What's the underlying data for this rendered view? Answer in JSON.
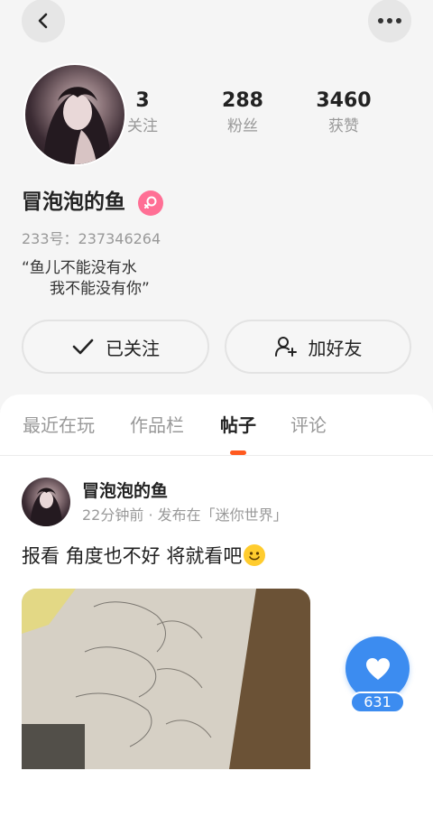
{
  "profile": {
    "username": "冒泡泡的鱼",
    "uid_text": "233号：237346264",
    "bio_line1": "“鱼儿不能没有水",
    "bio_line2": "我不能没有你”",
    "gender": "female"
  },
  "stats": {
    "following": {
      "value": "3",
      "label": "关注"
    },
    "fans": {
      "value": "288",
      "label": "粉丝"
    },
    "likes": {
      "value": "3460",
      "label": "获赞"
    }
  },
  "actions": {
    "follow_label": "已关注",
    "add_friend_label": "加好友"
  },
  "tabs": [
    "最近在玩",
    "作品栏",
    "帖子",
    "评论"
  ],
  "active_tab": "帖子",
  "post": {
    "author": "冒泡泡的鱼",
    "meta": "22分钟前 · 发布在「迷你世界」",
    "text": "报看 角度也不好 将就看吧",
    "like_count": "631"
  },
  "colors": {
    "accent_blue": "#3c8cf0",
    "tab_indicator": "#ff5a1f",
    "gender_badge": "#ff6f95"
  },
  "icons": [
    "back-icon",
    "more-icon",
    "female-icon",
    "check-icon",
    "add-user-icon",
    "heart-icon",
    "smile-emoji"
  ]
}
